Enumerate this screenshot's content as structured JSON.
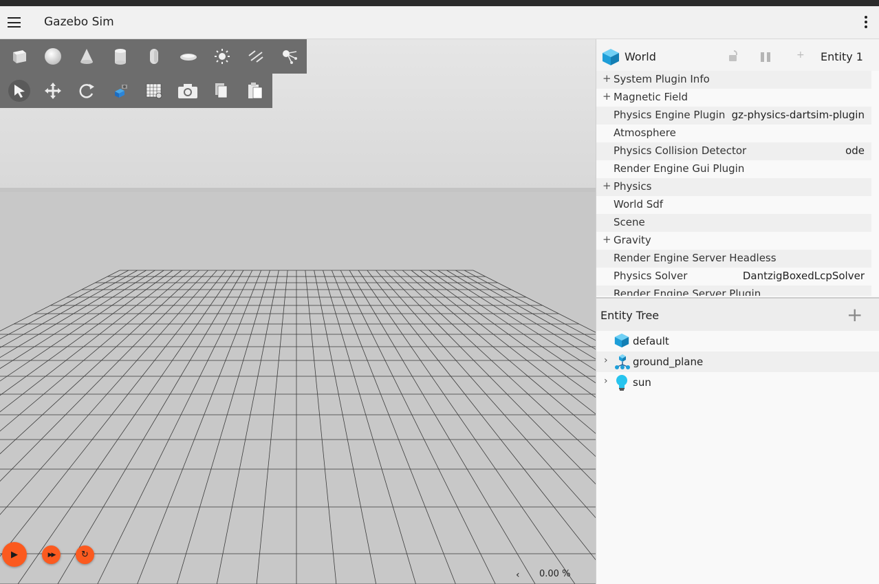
{
  "app": {
    "title": "Gazebo Sim"
  },
  "toolbar": {
    "shapes": [
      {
        "name": "box-icon",
        "label": "box"
      },
      {
        "name": "sphere-icon",
        "label": "sphere"
      },
      {
        "name": "cone-icon",
        "label": "cone"
      },
      {
        "name": "cylinder-icon",
        "label": "cylinder"
      },
      {
        "name": "capsule-icon",
        "label": "capsule"
      },
      {
        "name": "ellipsoid-icon",
        "label": "ellipsoid"
      },
      {
        "name": "point-light-icon",
        "label": "point light"
      },
      {
        "name": "directional-light-icon",
        "label": "directional light"
      },
      {
        "name": "spot-light-icon",
        "label": "spot light"
      }
    ],
    "transforms": [
      {
        "name": "select-arrow-icon",
        "label": "select",
        "selected": true
      },
      {
        "name": "translate-icon",
        "label": "translate"
      },
      {
        "name": "rotate-icon",
        "label": "rotate"
      },
      {
        "name": "view-angle-icon",
        "label": "view angle"
      },
      {
        "name": "grid-snap-icon",
        "label": "grid config"
      },
      {
        "name": "camera-icon",
        "label": "screenshot"
      },
      {
        "name": "copy-icon",
        "label": "copy"
      },
      {
        "name": "paste-icon",
        "label": "paste"
      }
    ]
  },
  "playback": {
    "play_glyph": "▶",
    "step_glyph": "▶▶",
    "reset_glyph": "↻",
    "rtf_arrow": "‹",
    "rtf_value": "0.00 %"
  },
  "component_inspector": {
    "entity_name": "World",
    "entity_id_label": "Entity 1",
    "add_glyph": "+",
    "rows": [
      {
        "expandable": true,
        "name": "System Plugin Info",
        "value": ""
      },
      {
        "expandable": true,
        "name": "Magnetic Field",
        "value": ""
      },
      {
        "expandable": false,
        "name": "Physics Engine Plugin",
        "value": "gz-physics-dartsim-plugin"
      },
      {
        "expandable": false,
        "name": "Atmosphere",
        "value": ""
      },
      {
        "expandable": false,
        "name": "Physics Collision Detector",
        "value": "ode"
      },
      {
        "expandable": false,
        "name": "Render Engine Gui Plugin",
        "value": ""
      },
      {
        "expandable": true,
        "name": "Physics",
        "value": ""
      },
      {
        "expandable": false,
        "name": "World Sdf",
        "value": ""
      },
      {
        "expandable": false,
        "name": "Scene",
        "value": ""
      },
      {
        "expandable": true,
        "name": "Gravity",
        "value": ""
      },
      {
        "expandable": false,
        "name": "Render Engine Server Headless",
        "value": ""
      },
      {
        "expandable": false,
        "name": "Physics Solver",
        "value": "DantzigBoxedLcpSolver"
      },
      {
        "expandable": false,
        "name": "Render Engine Server Plugin",
        "value": ""
      }
    ]
  },
  "entity_tree": {
    "title": "Entity Tree",
    "add_glyph": "+",
    "items": [
      {
        "label": "default",
        "icon": "world-cube-icon",
        "expandable": false
      },
      {
        "label": "ground_plane",
        "icon": "model-icon",
        "expandable": true
      },
      {
        "label": "sun",
        "icon": "light-bulb-icon",
        "expandable": true
      }
    ]
  },
  "colors": {
    "accent": "#fb5a1f",
    "toolbar_bg": "#6d6d6d",
    "entity_blue": "#1e9ed8"
  }
}
